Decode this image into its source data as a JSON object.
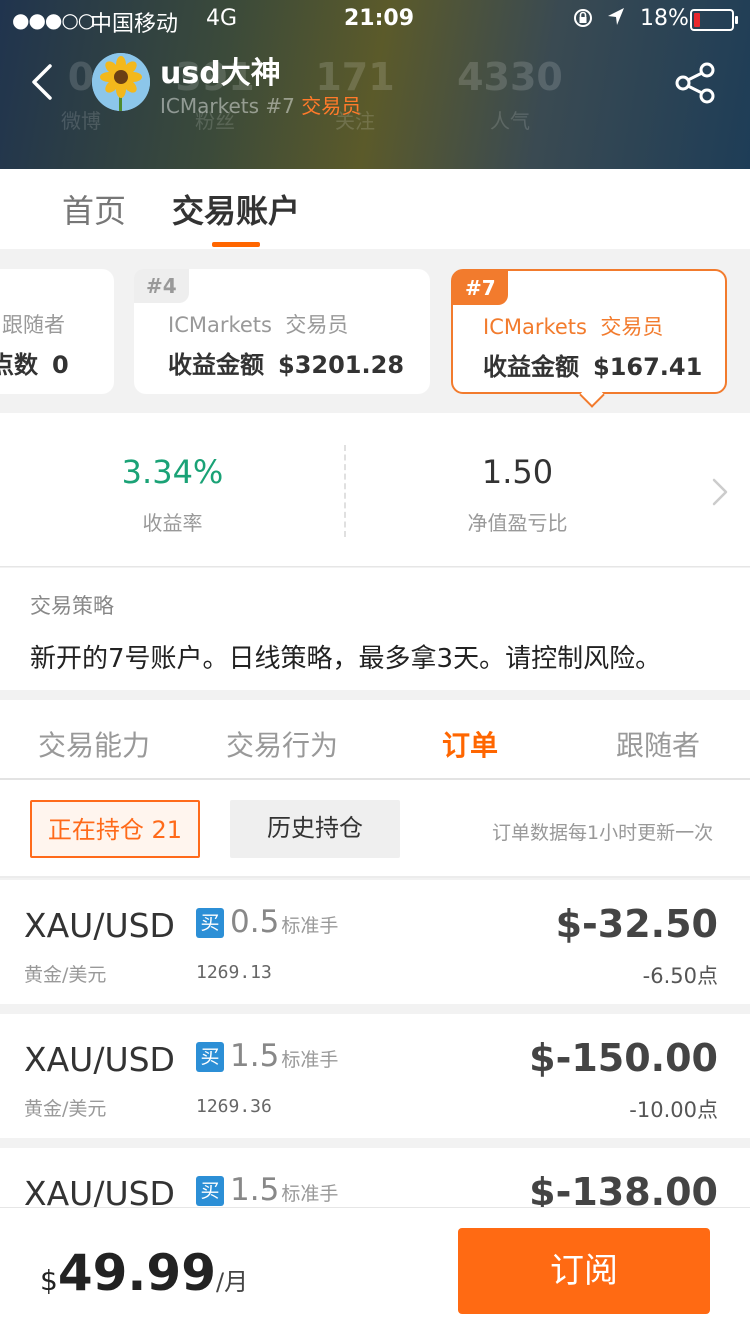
{
  "status_bar": {
    "signal": "●●●○○",
    "carrier": "中国移动",
    "network": "4G",
    "time": "21:09",
    "battery_percent": "18%",
    "battery_level": 0.18,
    "icons": [
      "orientation-lock-icon",
      "location-arrow-icon",
      "battery-icon"
    ]
  },
  "profile": {
    "name": "usd大神",
    "broker": "ICMarkets #7",
    "role": "交易员",
    "background_stats": [
      {
        "value": "0",
        "label": "微博"
      },
      {
        "value": "391",
        "label": "粉丝"
      },
      {
        "value": "171",
        "label": "关注"
      },
      {
        "value": "4330",
        "label": "人气"
      }
    ]
  },
  "main_tabs": [
    {
      "label": "首页",
      "active": false
    },
    {
      "label": "交易账户",
      "active": true
    }
  ],
  "accounts": [
    {
      "line1": "跟随者",
      "line2_label": "点数",
      "line2_value": "0"
    },
    {
      "badge": "#4",
      "broker": "ICMarkets",
      "role": "交易员",
      "label": "收益金额",
      "value": "$3201.28"
    },
    {
      "badge": "#7",
      "broker": "ICMarkets",
      "role": "交易员",
      "label": "收益金额",
      "value": "$167.41",
      "selected": true
    }
  ],
  "metrics": [
    {
      "value": "3.34%",
      "label": "收益率"
    },
    {
      "value": "1.50",
      "label": "净值盈亏比"
    }
  ],
  "strategy": {
    "title": "交易策略",
    "text": "新开的7号账户。日线策略，最多拿3天。请控制风险。"
  },
  "sub_tabs": [
    {
      "label": "交易能力",
      "active": false
    },
    {
      "label": "交易行为",
      "active": false
    },
    {
      "label": "订单",
      "active": true
    },
    {
      "label": "跟随者",
      "active": false
    }
  ],
  "filters": {
    "open_label": "正在持仓 21",
    "history_label": "历史持仓",
    "note": "订单数据每1小时更新一次"
  },
  "orders": [
    {
      "symbol": "XAU/USD",
      "symbol_cn": "黄金/美元",
      "side": "买",
      "lots": "0.5",
      "lot_unit": "标准手",
      "price": "1269.13",
      "pnl": "$-32.50",
      "points": "-6.50点"
    },
    {
      "symbol": "XAU/USD",
      "symbol_cn": "黄金/美元",
      "side": "买",
      "lots": "1.5",
      "lot_unit": "标准手",
      "price": "1269.36",
      "pnl": "$-150.00",
      "points": "-10.00点"
    },
    {
      "symbol": "XAU/USD",
      "symbol_cn": "",
      "side": "买",
      "lots": "1.5",
      "lot_unit": "标准手",
      "price": "",
      "pnl": "$-138.00",
      "points": ""
    }
  ],
  "subscription": {
    "currency": "$",
    "amount": "49.99",
    "period": "/月",
    "button_label": "订阅"
  },
  "colors": {
    "accent": "#ff6a13",
    "positive": "#1aa276",
    "buy_badge": "#2c8fd6",
    "battery_low": "#e8282e"
  }
}
